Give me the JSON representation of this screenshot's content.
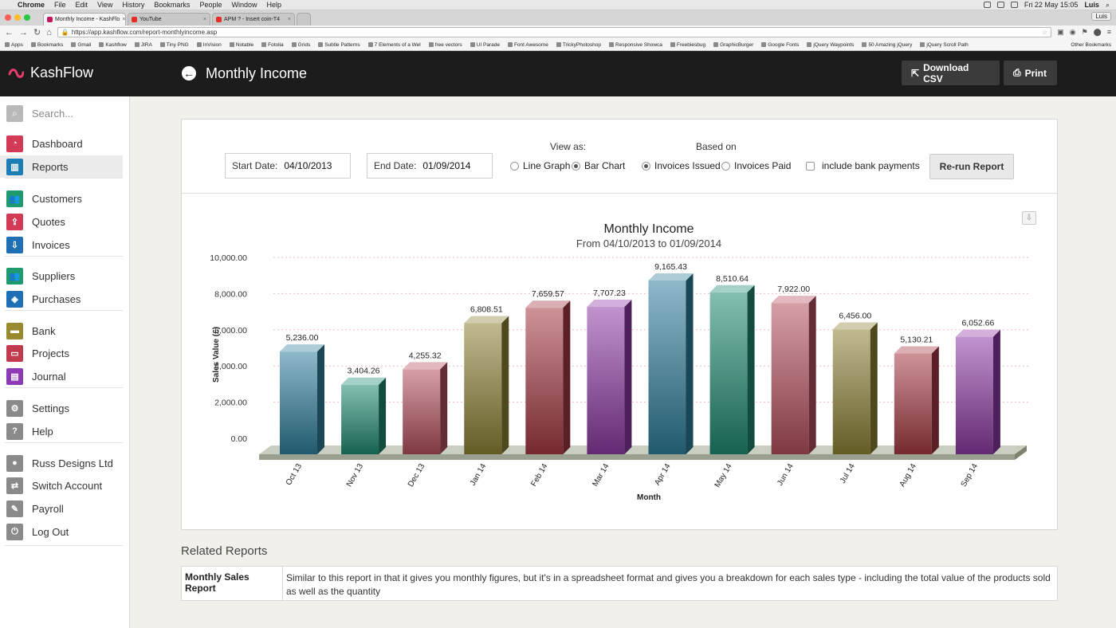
{
  "os_menubar": {
    "app": "Chrome",
    "menus": [
      "File",
      "Edit",
      "View",
      "History",
      "Bookmarks",
      "People",
      "Window",
      "Help"
    ],
    "clock": "Fri 22 May  15:05",
    "user": "Luis"
  },
  "browser": {
    "tabs": [
      {
        "title": "Monthly Income - KashFlo",
        "active": true,
        "color": "#c2185b"
      },
      {
        "title": "YouTube",
        "active": false,
        "color": "#e52d27"
      },
      {
        "title": "APM ? - Insert coin-T4",
        "active": false,
        "color": "#e52d27"
      }
    ],
    "profile": "Luis",
    "url": "https://app.kashflow.com/report-monthlyincome.asp",
    "bookmarks": [
      "Apps",
      "Bookmarks",
      "Gmail",
      "Kashflow",
      "JIRA",
      "Tiny PNG",
      "InVision",
      "Notable",
      "Fotolia",
      "Grids",
      "Subtle Patterns",
      "7 Elements of a Wel",
      "free vectors",
      "UI Parade",
      "Font Awesome",
      "TrickyPhotoshop",
      "Responsive Showca",
      "Freebiesbug",
      "GraphicBurger",
      "Google Fonts",
      "jQuery Waypoints",
      "50 Amazing jQuery",
      "jQuery Scroll Path"
    ],
    "other_bookmarks": "Other Bookmarks"
  },
  "header": {
    "brand": "KashFlow",
    "page_title": "Monthly Income",
    "download_label": "Download CSV",
    "print_label": "Print"
  },
  "sidebar": {
    "search_placeholder": "Search...",
    "items": [
      {
        "label": "Dashboard",
        "icon": "dashboard-icon",
        "color": "#d23a55",
        "glyph": "◔"
      },
      {
        "label": "Reports",
        "icon": "bar-chart-icon",
        "color": "#1f7db5",
        "glyph": "▥",
        "active": true
      },
      {
        "label": "Customers",
        "icon": "users-icon",
        "color": "#1f9a6f",
        "glyph": "👥"
      },
      {
        "label": "Quotes",
        "icon": "upload-icon",
        "color": "#d23a55",
        "glyph": "⇪"
      },
      {
        "label": "Invoices",
        "icon": "download-icon",
        "color": "#1f6fb5",
        "glyph": "⇩"
      },
      {
        "label": "Suppliers",
        "icon": "users-icon",
        "color": "#1f9a6f",
        "glyph": "👥"
      },
      {
        "label": "Purchases",
        "icon": "tag-icon",
        "color": "#1f6fb5",
        "glyph": "◈"
      },
      {
        "label": "Bank",
        "icon": "bank-icon",
        "color": "#9a8a2f",
        "glyph": "▬"
      },
      {
        "label": "Projects",
        "icon": "folder-icon",
        "color": "#c23a4d",
        "glyph": "▭"
      },
      {
        "label": "Journal",
        "icon": "book-icon",
        "color": "#8d3ab5",
        "glyph": "▤"
      },
      {
        "label": "Settings",
        "icon": "gear-icon",
        "color": "#8a8a8a",
        "glyph": "⚙"
      },
      {
        "label": "Help",
        "icon": "help-icon",
        "color": "#8a8a8a",
        "glyph": "?"
      },
      {
        "label": "Russ Designs Ltd",
        "icon": "user-icon",
        "color": "#8a8a8a",
        "glyph": "●"
      },
      {
        "label": "Switch Account",
        "icon": "switch-icon",
        "color": "#8a8a8a",
        "glyph": "⇄"
      },
      {
        "label": "Payroll",
        "icon": "payroll-icon",
        "color": "#8a8a8a",
        "glyph": "✎"
      },
      {
        "label": "Log Out",
        "icon": "power-icon",
        "color": "#8a8a8a",
        "glyph": "⏻"
      }
    ]
  },
  "filters": {
    "start_label": "Start Date:",
    "start_value": "04/10/2013",
    "end_label": "End Date:",
    "end_value": "01/09/2014",
    "view_as_label": "View as:",
    "view_options": [
      {
        "label": "Line Graph",
        "selected": false
      },
      {
        "label": "Bar Chart",
        "selected": true
      }
    ],
    "based_on_label": "Based on",
    "based_options": [
      {
        "label": "Invoices Issued",
        "selected": true
      },
      {
        "label": "Invoices Paid",
        "selected": false
      }
    ],
    "bank_label": "include bank payments",
    "bank_checked": false,
    "rerun_label": "Re-run Report"
  },
  "chart_data": {
    "type": "bar",
    "title": "Monthly Income",
    "subtitle": "From 04/10/2013 to 01/09/2014",
    "xlabel": "Month",
    "ylabel": "Sales Value (£)",
    "ylim": [
      0,
      10000
    ],
    "yticks": [
      "0.00",
      "2,000.00",
      "4,000.00",
      "6,000.00",
      "8,000.00",
      "10,000.00"
    ],
    "categories": [
      "Oct 13",
      "Nov 13",
      "Dec 13",
      "Jan 14",
      "Feb 14",
      "Mar 14",
      "Apr 14",
      "May 14",
      "Jun 14",
      "Jul 14",
      "Aug 14",
      "Sep 14"
    ],
    "values": [
      5236.0,
      3404.26,
      4255.32,
      6808.51,
      7659.57,
      7707.23,
      9165.43,
      8510.64,
      7922.0,
      6456.0,
      5130.21,
      6052.66
    ],
    "value_labels": [
      "5,236.00",
      "3,404.26",
      "4,255.32",
      "6,808.51",
      "7,659.57",
      "7,707.23",
      "9,165.43",
      "8,510.64",
      "7,922.00",
      "6,456.00",
      "5,130.21",
      "6,052.66"
    ],
    "colors": [
      "#2f7f9c",
      "#1f8a72",
      "#b5505e",
      "#8f8235",
      "#a63a43",
      "#8e3aa5",
      "#2f7f9c",
      "#1f8a72",
      "#b5505e",
      "#8f8235",
      "#a63a43",
      "#8e3aa5"
    ],
    "grid": true,
    "legend": "none"
  },
  "related": {
    "heading": "Related Reports",
    "rows": [
      {
        "name": "Monthly Sales Report",
        "description": "Similar to this report in that it gives you monthly figures, but it's in a spreadsheet format and gives you a breakdown for each sales type - including the total value of the products sold as well as the quantity"
      }
    ]
  }
}
